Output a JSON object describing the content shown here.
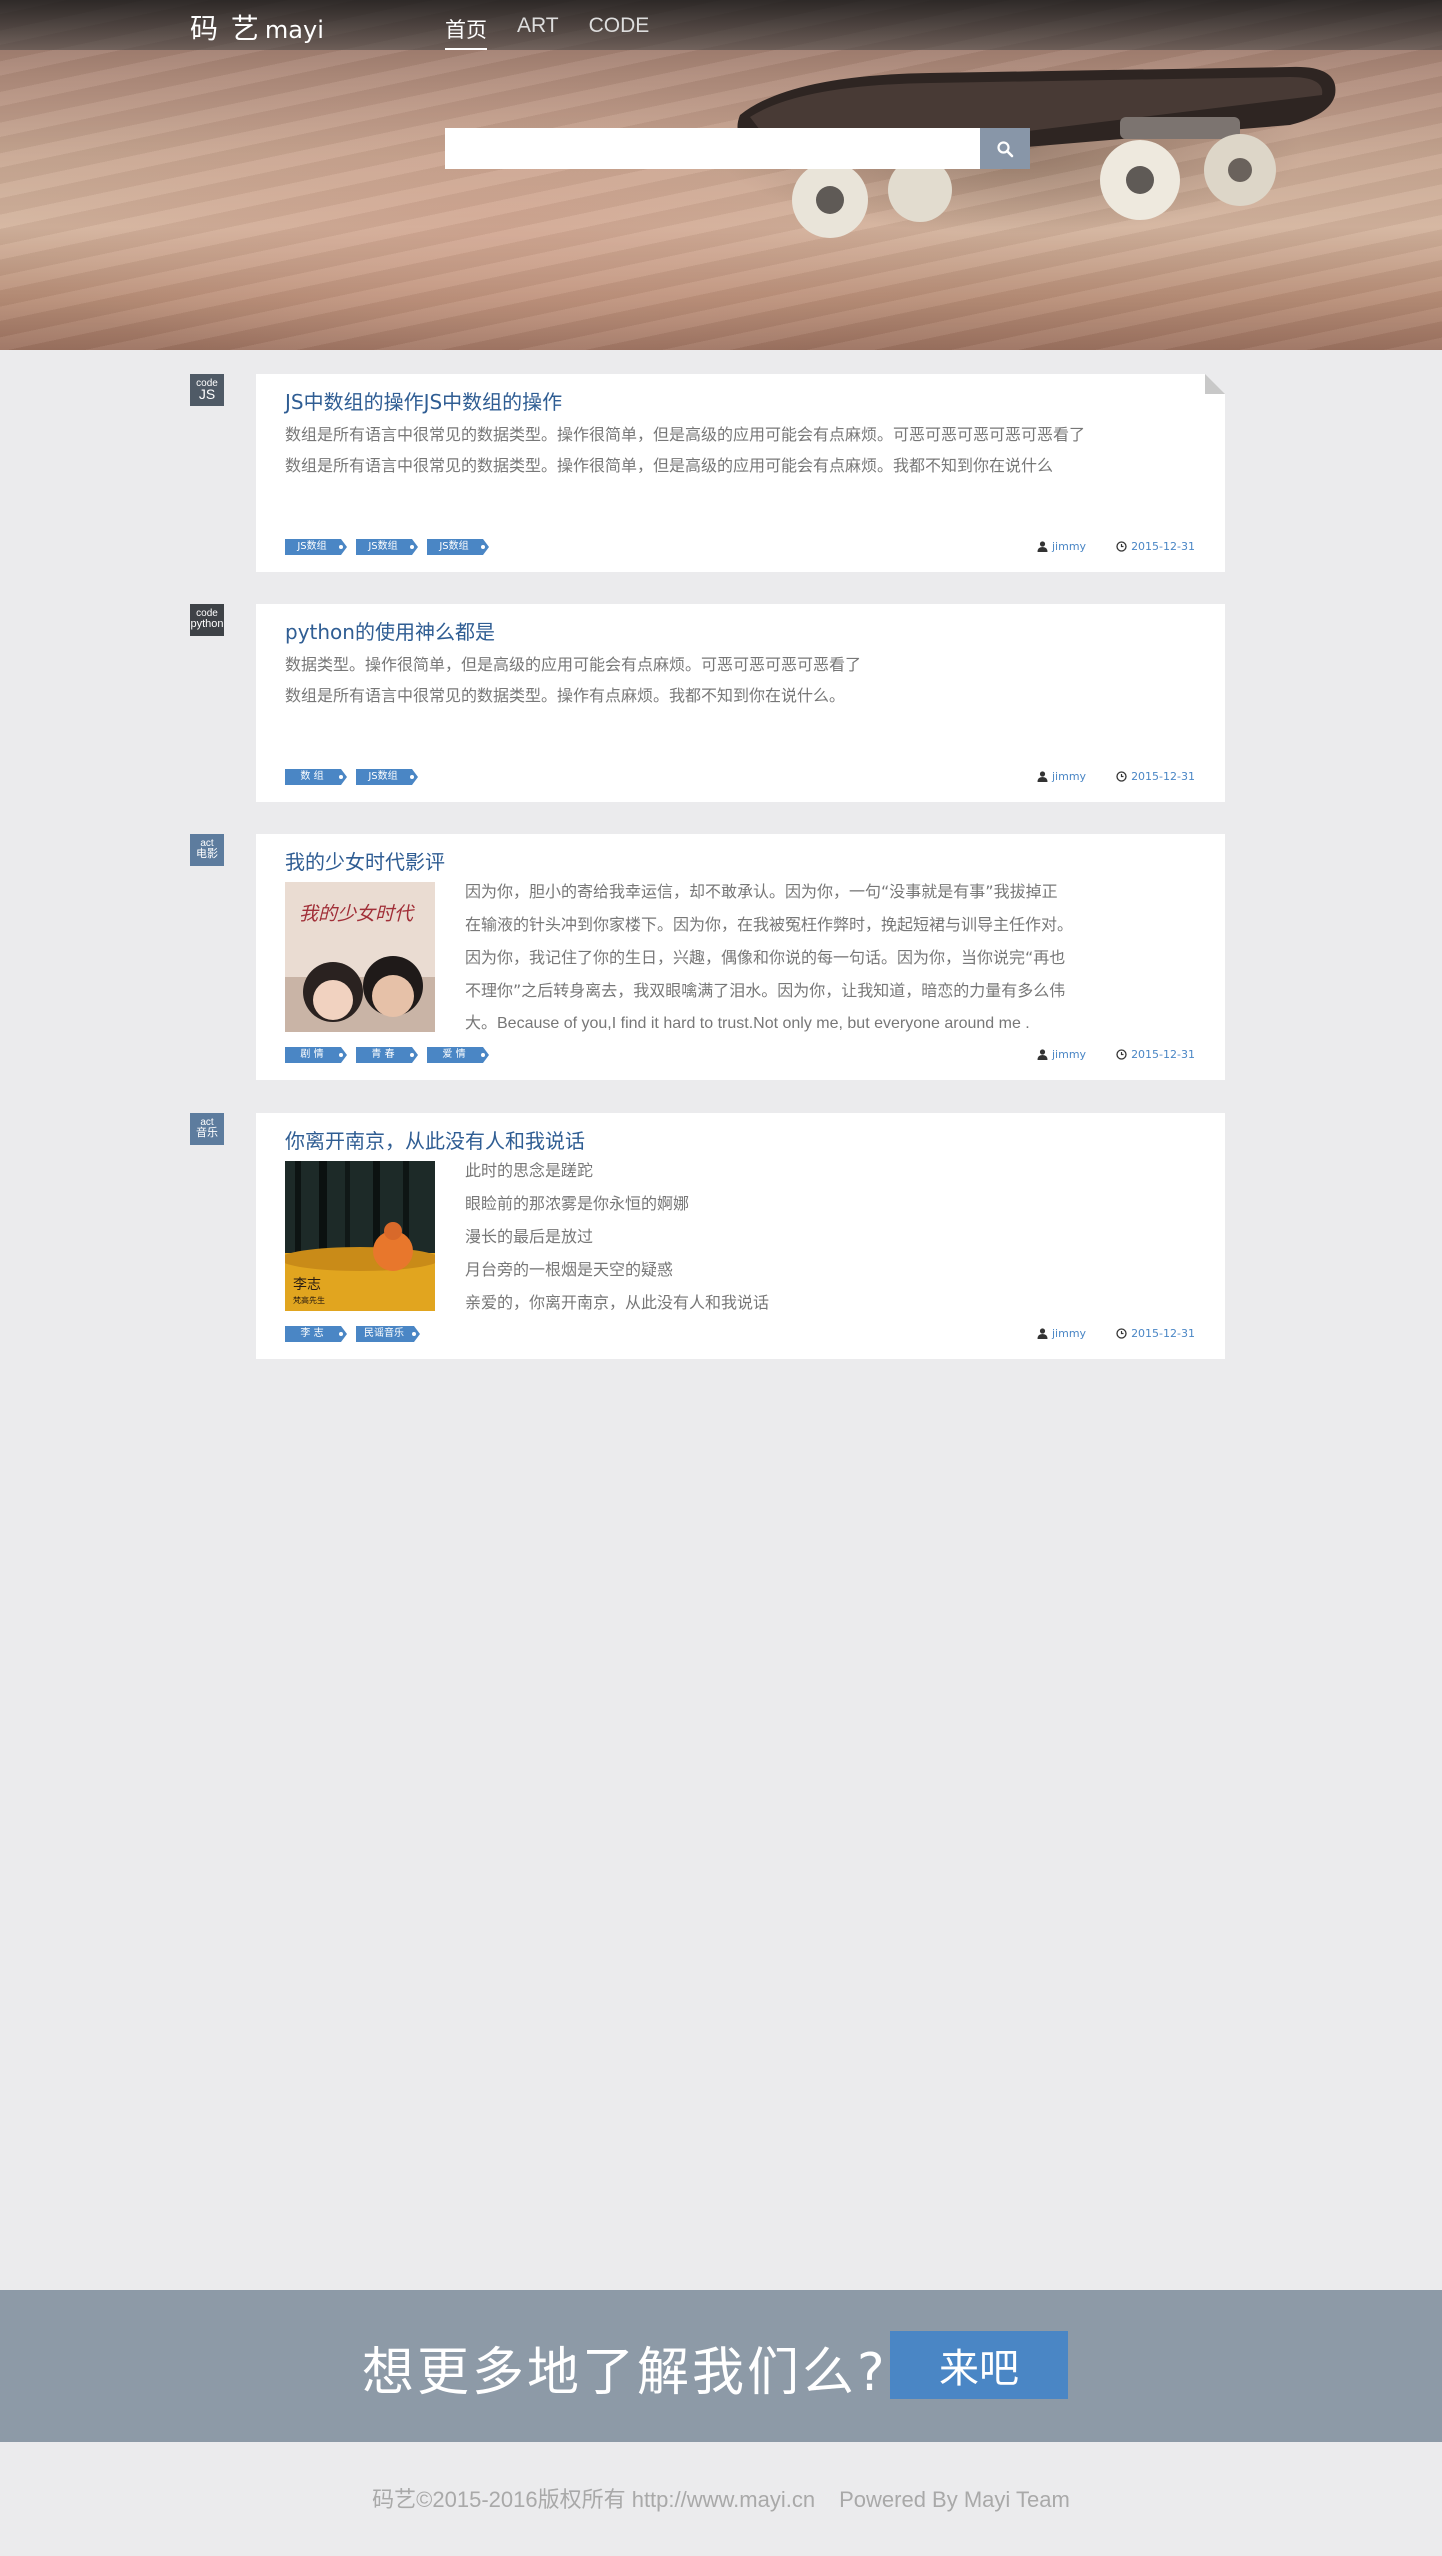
{
  "header": {
    "logo_cn": "码 艺",
    "logo_en": "mayi",
    "nav": [
      {
        "label": "首页",
        "active": true
      },
      {
        "label": "ART",
        "active": false
      },
      {
        "label": "CODE",
        "active": false
      }
    ]
  },
  "search": {
    "value": "",
    "placeholder": "",
    "icon": "search-icon"
  },
  "posts": [
    {
      "category_small": "code",
      "category_big": "JS",
      "title": "JS中数组的操作JS中数组的操作",
      "lines": [
        "数组是所有语言中很常见的数据类型。操作很简单，但是高级的应用可能会有点麻烦。可恶可恶可恶可恶可恶看了",
        "数组是所有语言中很常见的数据类型。操作很简单，但是高级的应用可能会有点麻烦。我都不知到你在说什么"
      ],
      "tags": [
        "JS数组",
        "JS数组",
        "JS数组"
      ],
      "author": "jimmy",
      "date": "2015-12-31"
    },
    {
      "category_small": "code",
      "category_big": "python",
      "title": "python的使用神么都是",
      "lines": [
        "数据类型。操作很简单，但是高级的应用可能会有点麻烦。可恶可恶可恶可恶看了",
        "数组是所有语言中很常见的数据类型。操作有点麻烦。我都不知到你在说什么。"
      ],
      "tags": [
        "数 组",
        "JS数组"
      ],
      "author": "jimmy",
      "date": "2015-12-31"
    },
    {
      "category_small": "act",
      "category_big": "电影",
      "title": "我的少女时代影评",
      "thumb_title": "我的少女时代",
      "lines": [
        "因为你，胆小的寄给我幸运信，却不敢承认。因为你，一句“没事就是有事”我拔掉正",
        "在输液的针头冲到你家楼下。因为你，在我被冤枉作弊时，挽起短裙与训导主任作对。",
        "因为你，我记住了你的生日，兴趣，偶像和你说的每一句话。因为你，当你说完“再也",
        "不理你”之后转身离去，我双眼噙满了泪水。因为你，让我知道，暗恋的力量有多么伟",
        "大。Because of you,I find it hard to trust.Not only me, but everyone around me ."
      ],
      "tags": [
        "剧 情",
        "青 春",
        "爱 情"
      ],
      "author": "jimmy",
      "date": "2015-12-31"
    },
    {
      "category_small": "act",
      "category_big": "音乐",
      "title": "你离开南京，从此没有人和我说话",
      "thumb_title": "李志",
      "thumb_subtitle": "梵高先生",
      "lines": [
        "此时的思念是蹉跎",
        "眼睑前的那浓雾是你永恒的婀娜",
        "漫长的最后是放过",
        "月台旁的一根烟是天空的疑惑",
        "亲爱的，你离开南京，从此没有人和我说话"
      ],
      "tags": [
        "李 志",
        "民谣音乐"
      ],
      "author": "jimmy",
      "date": "2015-12-31"
    }
  ],
  "cta": {
    "text": "想更多地了解我们么?",
    "button": "来吧"
  },
  "footer": {
    "copyright": "码艺©2015-2016版权所有 http://www.mayi.cn",
    "powered": "Powered By Mayi Team"
  },
  "colors": {
    "accent": "#4a86c5",
    "title": "#2f5d93",
    "cta_bg": "#8d9aa7",
    "page_bg": "#ebebed"
  }
}
